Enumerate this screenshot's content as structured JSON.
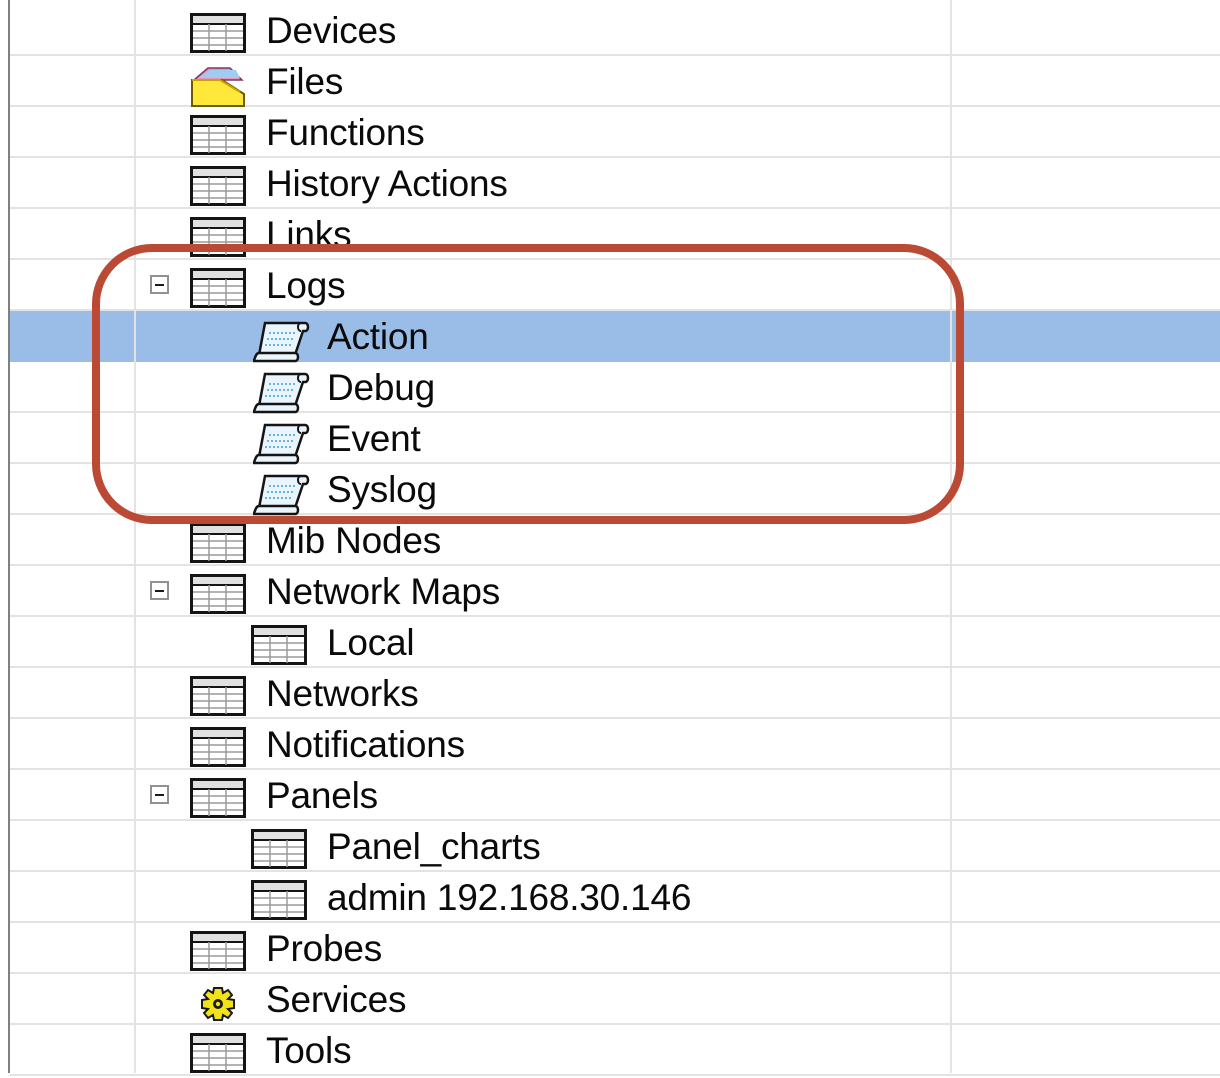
{
  "tree": {
    "items": [
      {
        "label": "Devices",
        "icon": "table-icon",
        "level": 1,
        "expanded": false,
        "selected": false
      },
      {
        "label": "Files",
        "icon": "folder-icon",
        "level": 1,
        "expanded": false,
        "selected": false
      },
      {
        "label": "Functions",
        "icon": "table-icon",
        "level": 1,
        "expanded": false,
        "selected": false
      },
      {
        "label": "History Actions",
        "icon": "table-icon",
        "level": 1,
        "expanded": false,
        "selected": false
      },
      {
        "label": "Links",
        "icon": "table-icon",
        "level": 1,
        "expanded": false,
        "selected": false
      },
      {
        "label": "Logs",
        "icon": "table-icon",
        "level": 1,
        "expanded": true,
        "selected": false
      },
      {
        "label": "Action",
        "icon": "log-scroll-icon",
        "level": 2,
        "expanded": false,
        "selected": true
      },
      {
        "label": "Debug",
        "icon": "log-scroll-icon",
        "level": 2,
        "expanded": false,
        "selected": false
      },
      {
        "label": "Event",
        "icon": "log-scroll-icon",
        "level": 2,
        "expanded": false,
        "selected": false
      },
      {
        "label": "Syslog",
        "icon": "log-scroll-icon",
        "level": 2,
        "expanded": false,
        "selected": false
      },
      {
        "label": "Mib Nodes",
        "icon": "table-icon",
        "level": 1,
        "expanded": false,
        "selected": false
      },
      {
        "label": "Network Maps",
        "icon": "table-icon",
        "level": 1,
        "expanded": true,
        "selected": false
      },
      {
        "label": "Local",
        "icon": "table-icon",
        "level": 2,
        "expanded": false,
        "selected": false
      },
      {
        "label": "Networks",
        "icon": "table-icon",
        "level": 1,
        "expanded": false,
        "selected": false
      },
      {
        "label": "Notifications",
        "icon": "table-icon",
        "level": 1,
        "expanded": false,
        "selected": false
      },
      {
        "label": "Panels",
        "icon": "table-icon",
        "level": 1,
        "expanded": true,
        "selected": false
      },
      {
        "label": "Panel_charts",
        "icon": "table-icon",
        "level": 2,
        "expanded": false,
        "selected": false
      },
      {
        "label": "admin 192.168.30.146",
        "icon": "table-icon",
        "level": 2,
        "expanded": false,
        "selected": false
      },
      {
        "label": "Probes",
        "icon": "table-icon",
        "level": 1,
        "expanded": false,
        "selected": false
      },
      {
        "label": "Services",
        "icon": "gear-icon",
        "level": 1,
        "expanded": false,
        "selected": false
      },
      {
        "label": "Tools",
        "icon": "table-icon",
        "level": 1,
        "expanded": false,
        "selected": false
      }
    ]
  },
  "colors": {
    "selection": "#99bde7",
    "highlight_outline": "#bb4a35",
    "grid_line": "#e3e3e3"
  }
}
